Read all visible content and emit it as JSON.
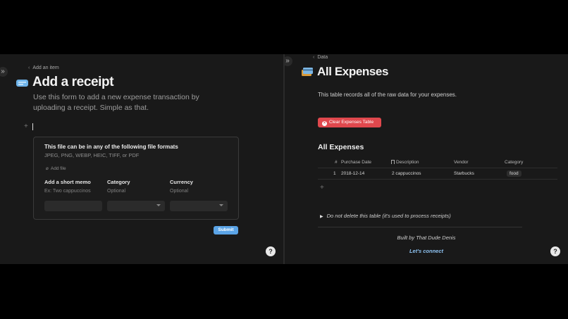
{
  "left": {
    "breadcrumb": "Add an item",
    "title": "Add a receipt",
    "description": "Use this form to add a new expense transaction by uploading a receipt. Simple as that.",
    "form": {
      "formats_title": "This file can be in any of the following file formats",
      "formats_list": "JPEG, PNG, WEBP, HEIC, TIFF, or PDF",
      "add_file": "Add file",
      "fields": [
        {
          "label": "Add a short memo",
          "placeholder": "Ex: Two cappuccinos"
        },
        {
          "label": "Category",
          "placeholder": "Optional"
        },
        {
          "label": "Currency",
          "placeholder": "Optional"
        }
      ]
    },
    "submit_label": "Submit",
    "help": "?"
  },
  "right": {
    "breadcrumb": "Data",
    "title": "All Expenses",
    "description": "This table records all of the raw data for your expenses.",
    "clear_button": "Clear Expenses Table",
    "section_title": "All Expenses",
    "table": {
      "headers": [
        "#",
        "Purchase Date",
        "Description",
        "Vendor",
        "Category"
      ],
      "rows": [
        {
          "num": "1",
          "date": "2018-12-14",
          "description": "2 cappuccinos",
          "vendor": "Starbucks",
          "category": "food"
        }
      ]
    },
    "toggle": "Do not delete this table (it's used to process receipts)",
    "built_by": "Built by That Dude Denis",
    "connect": "Let's connect",
    "help": "?"
  },
  "colors": {
    "accent": "#5ba4e6",
    "danger": "#e0484d",
    "link": "#8ec3f2",
    "background": "#191919"
  }
}
